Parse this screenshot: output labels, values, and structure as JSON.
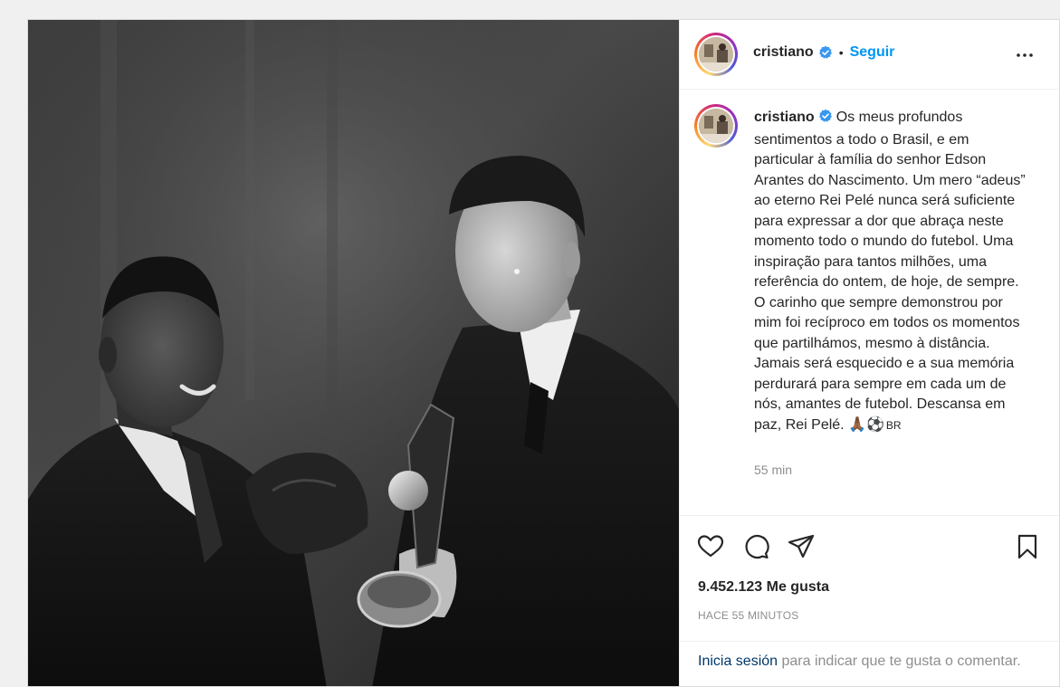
{
  "post": {
    "username": "cristiano",
    "separator": "•",
    "follow_label": "Seguir",
    "caption_prefix": "cristiano",
    "caption_body": "Os meus profundos sentimentos a todo o Brasil, e em particular à família do senhor Edson Arantes do Nascimento. Um mero “adeus” ao eterno Rei Pelé nunca será suficiente para expressar a dor que abraça neste momento todo o mundo do futebol. Uma inspiração para tantos milhões, uma referência do ontem, de hoje, de sempre. O carinho que sempre demonstrou por mim foi recíproco em todos os momentos que partilhámos, mesmo à distância. Jamais será esquecido e a sua memória perdurará para sempre em cada um de nós, amantes de futebol. Descansa em paz, Rei Pelé. 🙏🏾⚽️",
    "caption_flag_text": "BR",
    "caption_time": "55 min",
    "likes": "9.452.123 Me gusta",
    "posted_ago": "HACE 55 MINUTOS",
    "login_link": "Inicia sesión",
    "login_rest": " para indicar que te gusta o comentar."
  },
  "icons": {
    "verified": "verified-badge-icon",
    "more": "more-options-icon",
    "like": "heart-icon",
    "comment": "comment-icon",
    "share": "paper-plane-icon",
    "save": "bookmark-icon"
  },
  "colors": {
    "link_blue": "#0095f6",
    "dark_link": "#00376b",
    "text": "#262626",
    "muted": "#8e8e8e",
    "verified_blue": "#3897f0"
  }
}
